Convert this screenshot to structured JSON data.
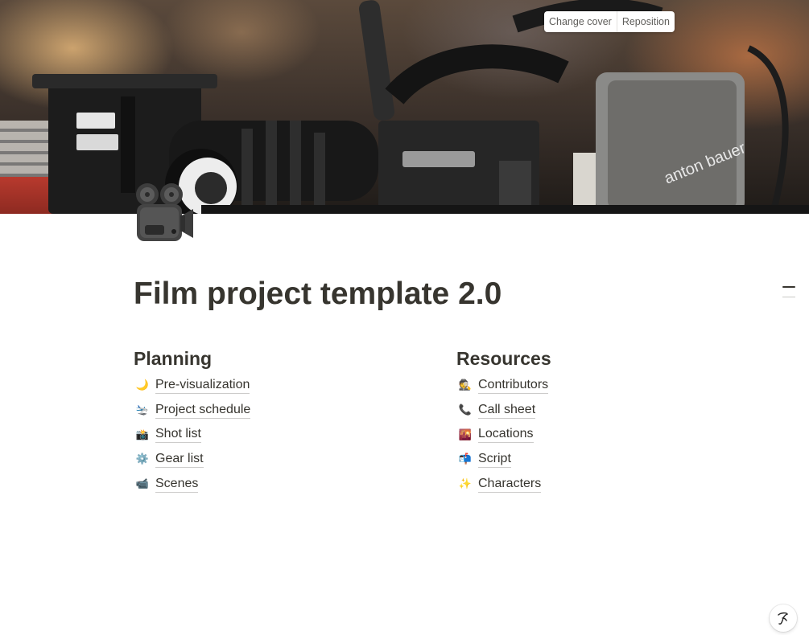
{
  "cover": {
    "change_cover_label": "Change cover",
    "reposition_label": "Reposition"
  },
  "page": {
    "icon": "movie-camera-icon",
    "title": "Film project template 2.0"
  },
  "columns": [
    {
      "heading": "Planning",
      "items": [
        {
          "emoji": "🌙",
          "icon": "crescent-moon-icon",
          "label": "Pre-visualization"
        },
        {
          "emoji": "🛬",
          "icon": "airplane-arrival-icon",
          "label": "Project schedule"
        },
        {
          "emoji": "📸",
          "icon": "camera-flash-icon",
          "label": "Shot list"
        },
        {
          "emoji": "⚙️",
          "icon": "gear-icon",
          "label": "Gear list"
        },
        {
          "emoji": "📹",
          "icon": "video-camera-icon",
          "label": "Scenes"
        }
      ]
    },
    {
      "heading": "Resources",
      "items": [
        {
          "emoji": "🕵️",
          "icon": "detective-icon",
          "label": "Contributors"
        },
        {
          "emoji": "📞",
          "icon": "telephone-receiver-icon",
          "label": "Call sheet"
        },
        {
          "emoji": "🌇",
          "icon": "city-sunset-icon",
          "label": "Locations"
        },
        {
          "emoji": "📬",
          "icon": "mailbox-icon",
          "label": "Script"
        },
        {
          "emoji": "✨",
          "icon": "sparkles-icon",
          "label": "Characters"
        }
      ]
    }
  ],
  "help": {
    "icon": "help-signature-icon"
  }
}
